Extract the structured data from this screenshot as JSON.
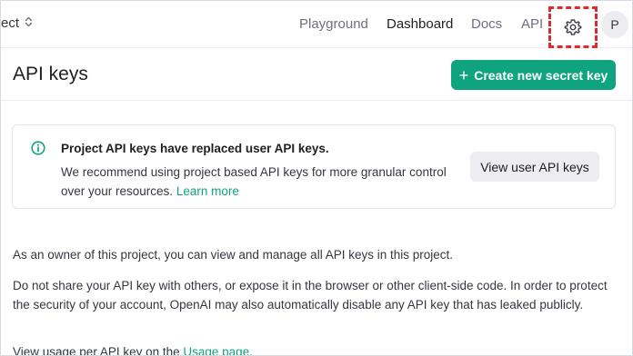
{
  "nav": {
    "project_label": "ect",
    "links": [
      "Playground",
      "Dashboard",
      "Docs",
      "API"
    ],
    "active": "Dashboard",
    "avatar_initial": "P",
    "icons": {
      "project_switch": "chevron-updown-icon",
      "settings": "gear-icon"
    }
  },
  "header": {
    "title": "API keys",
    "create_button": "Create new secret key"
  },
  "notice": {
    "title": "Project API keys have replaced user API keys.",
    "body": "We recommend using project based API keys for more granular control over your resources.",
    "link": "Learn more",
    "button": "View user API keys",
    "icon": "info-circle-icon"
  },
  "body": {
    "para1": "As an owner of this project, you can view and manage all API keys in this project.",
    "para2": "Do not share your API key with others, or expose it in the browser or other client-side code. In order to protect the security of your account, OpenAI may also automatically disable any API key that has leaked publicly.",
    "para3_prefix": "View usage per API key on the",
    "para3_link": "Usage page",
    "para3_suffix": "."
  },
  "colors": {
    "accent": "#10a37f",
    "highlight_border": "#e5262b"
  }
}
